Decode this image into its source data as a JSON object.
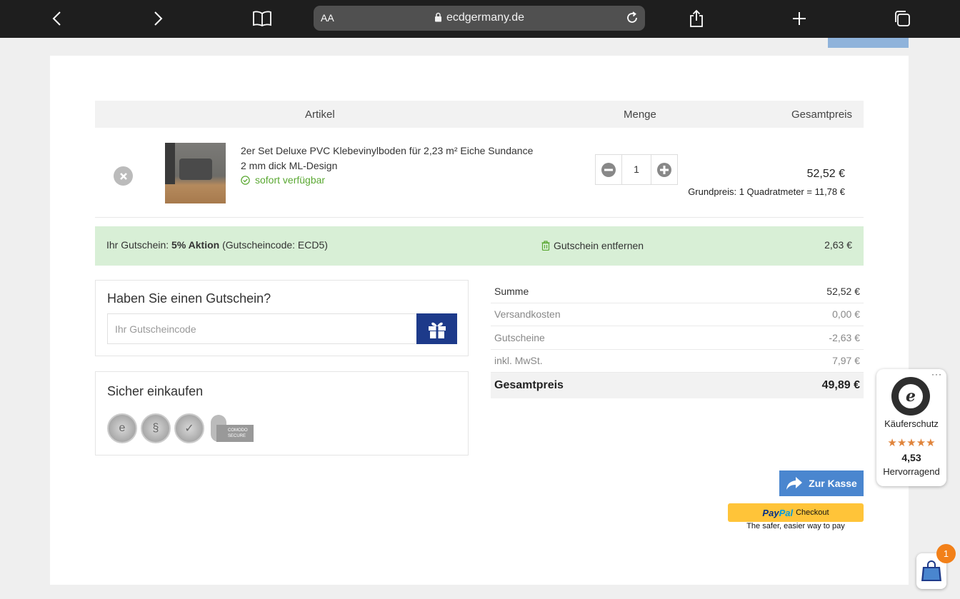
{
  "browser": {
    "url_aa": "AA",
    "domain": "ecdgermany.de"
  },
  "table": {
    "col_article": "Artikel",
    "col_qty": "Menge",
    "col_total": "Gesamtpreis"
  },
  "item": {
    "title": "2er Set Deluxe PVC Klebevinylboden für 2,23 m² Eiche Sundance 2 mm dick ML-Design",
    "availability": "sofort verfügbar",
    "quantity": "1",
    "price": "52,52 €",
    "unit_price": "Grundpreis: 1 Quadratmeter = 11,78 €"
  },
  "voucher": {
    "prefix": "Ihr Gutschein: ",
    "name": "5% Aktion",
    "code_text": " (Gutscheincode: ECD5)",
    "remove_label": "Gutschein entfernen",
    "amount": "2,63 €"
  },
  "coupon_box": {
    "title": "Haben Sie einen Gutschein?",
    "placeholder": "Ihr Gutscheincode"
  },
  "secure_box": {
    "title": "Sicher einkaufen",
    "comodo_text": "COMODO SECURE"
  },
  "totals": [
    {
      "label": "Summe",
      "value": "52,52 €"
    },
    {
      "label": "Versandkosten",
      "value": "0,00 €"
    },
    {
      "label": "Gutscheine",
      "value": "-2,63 €"
    },
    {
      "label": "inkl. MwSt.",
      "value": "7,97 €"
    }
  ],
  "grand_total": {
    "label": "Gesamtpreis",
    "value": "49,89 €"
  },
  "checkout": {
    "button_label": "Zur Kasse",
    "paypal_pay": "Pay",
    "paypal_pal": "Pal",
    "paypal_checkout": "Checkout",
    "paypal_tagline": "The safer, easier way to pay"
  },
  "trusted_shops": {
    "label": "Käuferschutz",
    "stars": "★★★★★",
    "score": "4,53",
    "rating": "Hervorragend",
    "menu": "···"
  },
  "cart": {
    "count": "1"
  },
  "colors": {
    "accent_blue": "#4a86cf",
    "coupon_navy": "#1d3a8a",
    "voucher_green_bg": "#d8efd6",
    "available_green": "#5aa832",
    "paypal_yellow": "#ffc439",
    "badge_orange": "#f28019"
  }
}
